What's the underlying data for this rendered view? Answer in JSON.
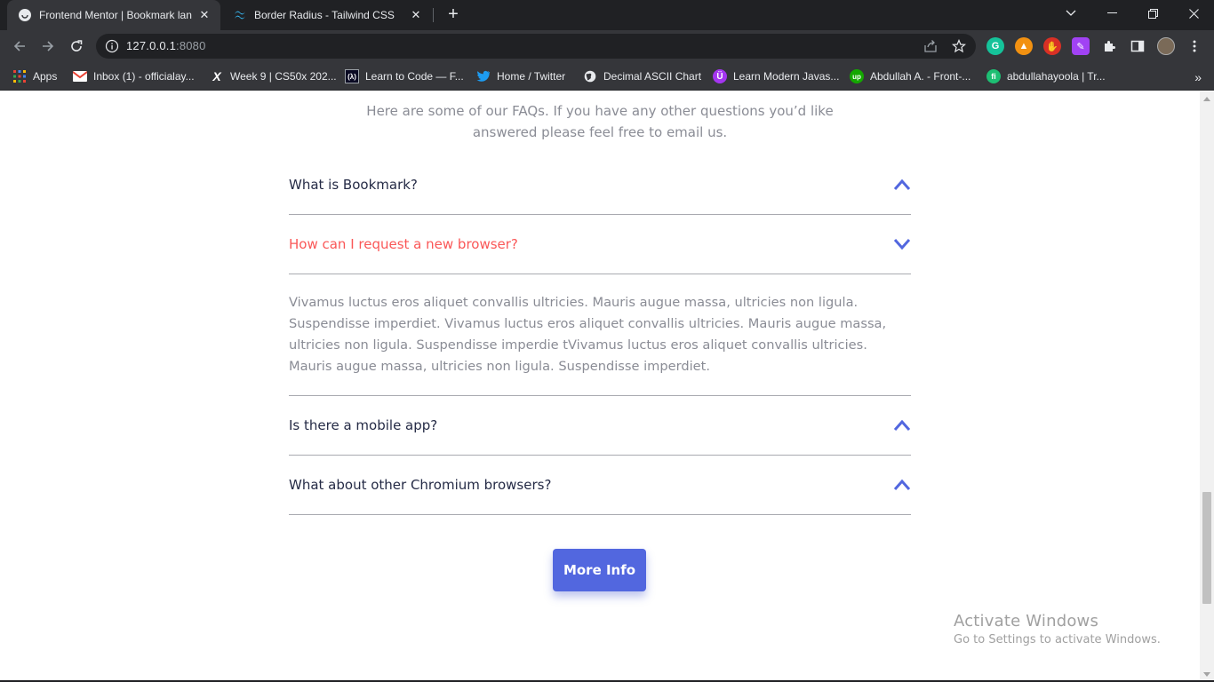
{
  "browser": {
    "tabs": [
      {
        "title": "Frontend Mentor | Bookmark lan",
        "active": true
      },
      {
        "title": "Border Radius - Tailwind CSS",
        "active": false
      }
    ],
    "url_host": "127.0.0.1",
    "url_port": ":8080",
    "bookmarks": [
      {
        "label": "Apps",
        "icon": "apps-grid-icon"
      },
      {
        "label": "Inbox (1) - officialay...",
        "icon": "gmail-icon"
      },
      {
        "label": "Week 9 | CS50x 202...",
        "icon": "x-icon"
      },
      {
        "label": "Learn to Code — F...",
        "icon": "freecodecamp-icon"
      },
      {
        "label": "Home / Twitter",
        "icon": "twitter-icon"
      },
      {
        "label": "Decimal ASCII Chart",
        "icon": "globe-icon"
      },
      {
        "label": "Learn Modern Javas...",
        "icon": "purple-u-icon"
      },
      {
        "label": "Abdullah A. - Front-...",
        "icon": "upwork-icon"
      },
      {
        "label": "abdullahayoola | Tr...",
        "icon": "fiverr-icon"
      }
    ]
  },
  "faq": {
    "intro": "Here are some of our FAQs. If you have any other questions you’d like answered please feel free to email us.",
    "items": [
      {
        "question": "What is Bookmark?",
        "open": false
      },
      {
        "question": "How can I request a new browser?",
        "open": true,
        "answer": "Vivamus luctus eros aliquet convallis ultricies. Mauris augue massa, ultricies non ligula. Suspendisse imperdiet. Vivamus luctus eros aliquet convallis ultricies. Mauris augue massa, ultricies non ligula. Suspendisse imperdie tVivamus luctus eros aliquet convallis ultricies. Mauris augue massa, ultricies non ligula. Suspendisse imperdiet."
      },
      {
        "question": "Is there a mobile app?",
        "open": false
      },
      {
        "question": "What about other Chromium browsers?",
        "open": false
      }
    ],
    "more_info_label": "More Info"
  },
  "watermark": {
    "title": "Activate Windows",
    "subtitle": "Go to Settings to activate Windows."
  },
  "colors": {
    "accent_blue": "#5267df",
    "soft_red": "#fa5757",
    "dark_text": "#252b46",
    "grey_text": "#8a8c95"
  }
}
